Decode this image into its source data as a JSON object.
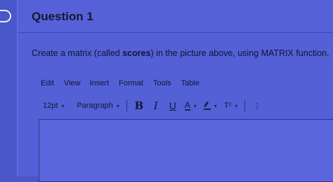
{
  "question": {
    "title": "Question 1",
    "prompt_before": "Create a matrix (called ",
    "prompt_bold": "scores",
    "prompt_after": ") in the picture above, using MATRIX function."
  },
  "menu": {
    "items": [
      "Edit",
      "View",
      "Insert",
      "Format",
      "Tools",
      "Table"
    ]
  },
  "toolbar": {
    "font_size": "12pt",
    "block_format": "Paragraph",
    "bold": "B",
    "italic": "I",
    "underline": "U",
    "text_color": "A",
    "superscript": "T²",
    "more": "⋮"
  }
}
